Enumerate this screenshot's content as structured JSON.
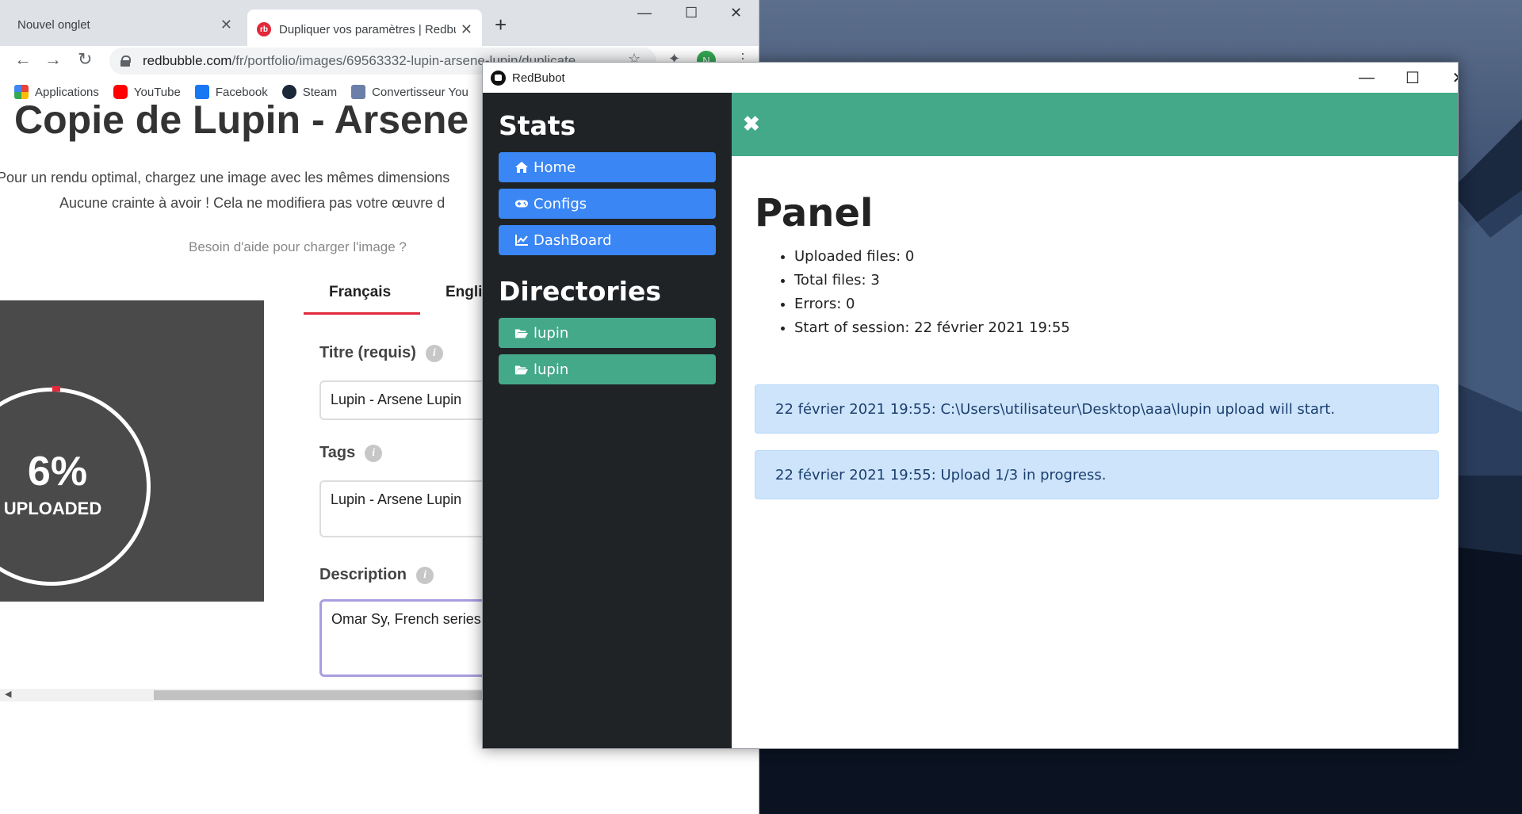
{
  "chrome": {
    "tabs": [
      {
        "title": "Nouvel onglet",
        "close": "✕"
      },
      {
        "title": "Dupliquer vos paramètres | Redbubble",
        "close": "✕"
      }
    ],
    "new_tab": "+",
    "window_controls": {
      "minimize": "—",
      "maximize": "☐",
      "close": "✕"
    },
    "nav": {
      "back": "←",
      "forward": "→",
      "reload": "↻"
    },
    "url_host": "redbubble.com",
    "url_path": "/fr/portfolio/images/69563332-lupin-arsene-lupin/duplicate",
    "toolbar_icons": {
      "star": "☆",
      "extensions": "✦",
      "menu": "⋮"
    },
    "profile_initial": "N",
    "bookmarks": [
      "Applications",
      "YouTube",
      "Facebook",
      "Steam",
      "Convertisseur You"
    ]
  },
  "page": {
    "title": "Copie de Lupin - Arsene Lupin",
    "intro_line1": "Pour un rendu optimal, chargez une image avec les mêmes dimensions",
    "intro_line2": "Aucune crainte à avoir ! Cela ne modifiera pas votre œuvre d",
    "help_link": "Besoin d'aide pour charger l'image ?",
    "language_tabs": [
      "Français",
      "English"
    ],
    "upload": {
      "percent": "6%",
      "label": "UPLOADED",
      "progress": 0.06
    },
    "fields": {
      "title_label": "Titre (requis)",
      "title_value": "Lupin - Arsene Lupin",
      "tags_label": "Tags",
      "tags_value": "Lupin - Arsene Lupin",
      "description_label": "Description",
      "description_value": "Omar Sy, French series"
    },
    "info_glyph": "i",
    "scroll_arrow": "◀"
  },
  "redbubot": {
    "window_title": "RedBubot",
    "window_controls": {
      "minimize": "—",
      "maximize": "☐",
      "close": "✕"
    },
    "sidebar": {
      "stats_heading": "Stats",
      "nav": [
        {
          "label": "Home",
          "icon": "home-icon"
        },
        {
          "label": "Configs",
          "icon": "gamepad-icon"
        },
        {
          "label": "DashBoard",
          "icon": "chart-line-icon"
        }
      ],
      "directories_heading": "Directories",
      "directories": [
        {
          "label": "lupin",
          "icon": "folder-open-icon"
        },
        {
          "label": "lupin",
          "icon": "folder-open-icon"
        }
      ]
    },
    "main": {
      "close_glyph": "✖",
      "heading": "Panel",
      "stats": [
        "Uploaded files: 0",
        "Total files: 3",
        "Errors: 0",
        "Start of session: 22 février 2021 19:55"
      ],
      "alerts": [
        "22 février 2021 19:55: C:\\Users\\utilisateur\\Desktop\\aaa\\lupin upload will start.",
        "22 février 2021 19:55: Upload 1/3 in progress."
      ]
    },
    "colors": {
      "sidebar_bg": "#202326",
      "blue_button": "#3a86f5",
      "green": "#44a989",
      "alert_bg": "#cde4fb"
    }
  }
}
